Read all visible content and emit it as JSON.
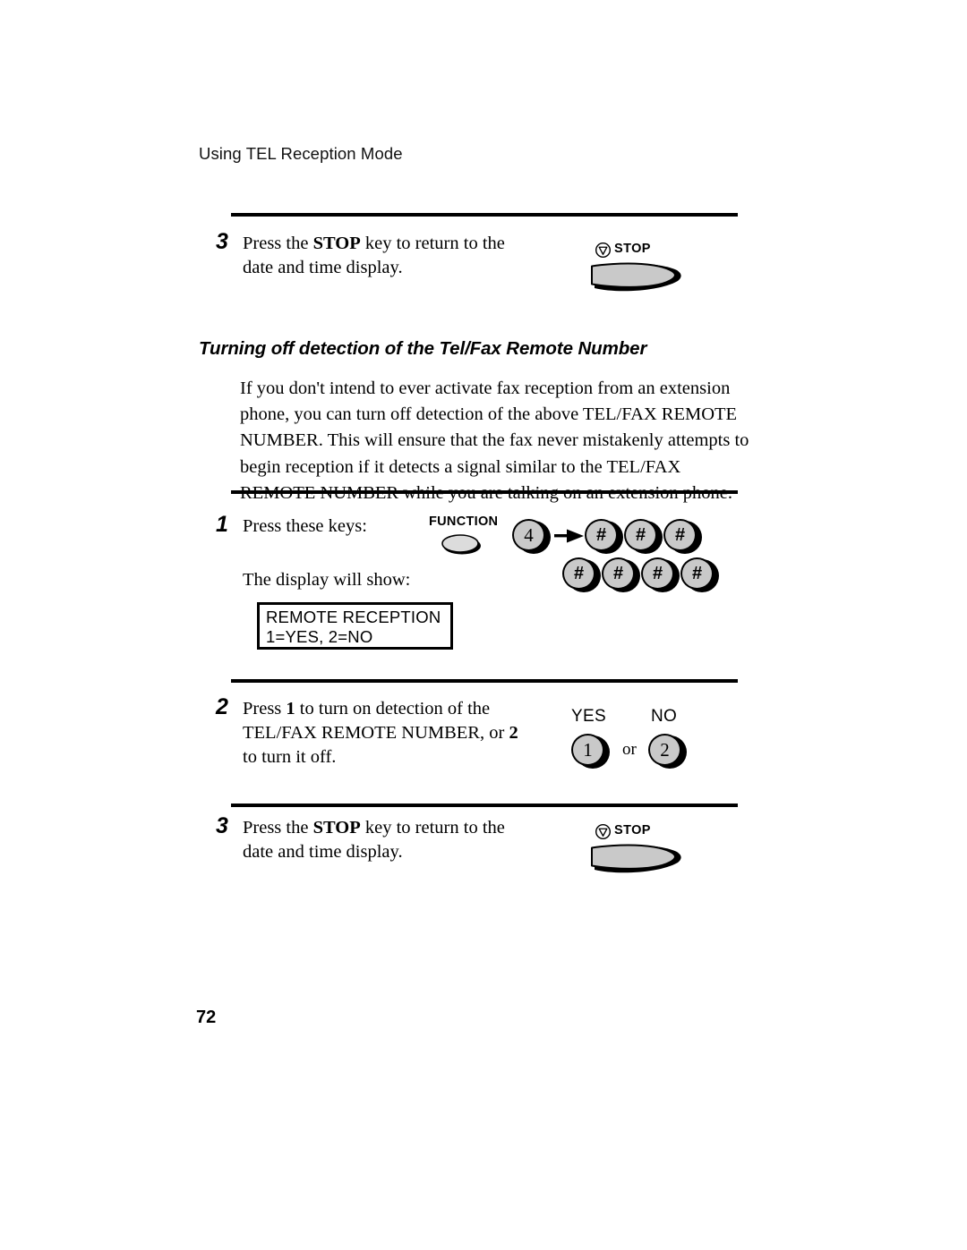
{
  "page": {
    "running_header": "Using TEL Reception Mode",
    "page_number": "72"
  },
  "steps": {
    "top_step3": {
      "number": "3",
      "line1_pre": "Press the ",
      "line1_bold": "STOP",
      "line1_post": " key to return to the",
      "line2": "date and time display."
    },
    "step1": {
      "number": "1",
      "line1": "Press these keys:",
      "line2": "The display will show:"
    },
    "step2": {
      "number": "2",
      "line1_pre": "Press ",
      "line1_bold": "1",
      "line1_post": " to turn on detection of the",
      "line2_pre": "TEL/FAX REMOTE NUMBER, or ",
      "line2_bold": "2",
      "line3": "to turn it off."
    },
    "bottom_step3": {
      "number": "3",
      "line1_pre": "Press the ",
      "line1_bold": "STOP",
      "line1_post": " key to return to the",
      "line2": "date and time display."
    }
  },
  "section": {
    "heading": "Turning off detection of the Tel/Fax Remote Number",
    "paragraph_lines": [
      "If you don't intend to ever activate fax reception from an extension",
      "phone, you can turn off detection of the above TEL/FAX REMOTE",
      "NUMBER. This will ensure that the fax never mistakenly attempts to",
      "begin reception if it detects a signal similar to the TEL/FAX",
      "REMOTE NUMBER while you are talking on an extension phone."
    ]
  },
  "lcd": {
    "line1": "REMOTE RECEPTION",
    "line2": "1=YES, 2=NO"
  },
  "keys": {
    "stop_label": "STOP",
    "function_label": "FUNCTION",
    "key_4": "4",
    "hash": "#",
    "hash_row_top": [
      "#",
      "#",
      "#"
    ],
    "hash_row_bottom": [
      "#",
      "#",
      "#",
      "#"
    ],
    "yes_label": "YES",
    "no_label": "NO",
    "key_1": "1",
    "key_2": "2",
    "or_label": "or"
  },
  "colors": {
    "key_face": "#c9c9c9",
    "key_outline": "#000000",
    "ink": "#000000",
    "paper": "#ffffff"
  }
}
